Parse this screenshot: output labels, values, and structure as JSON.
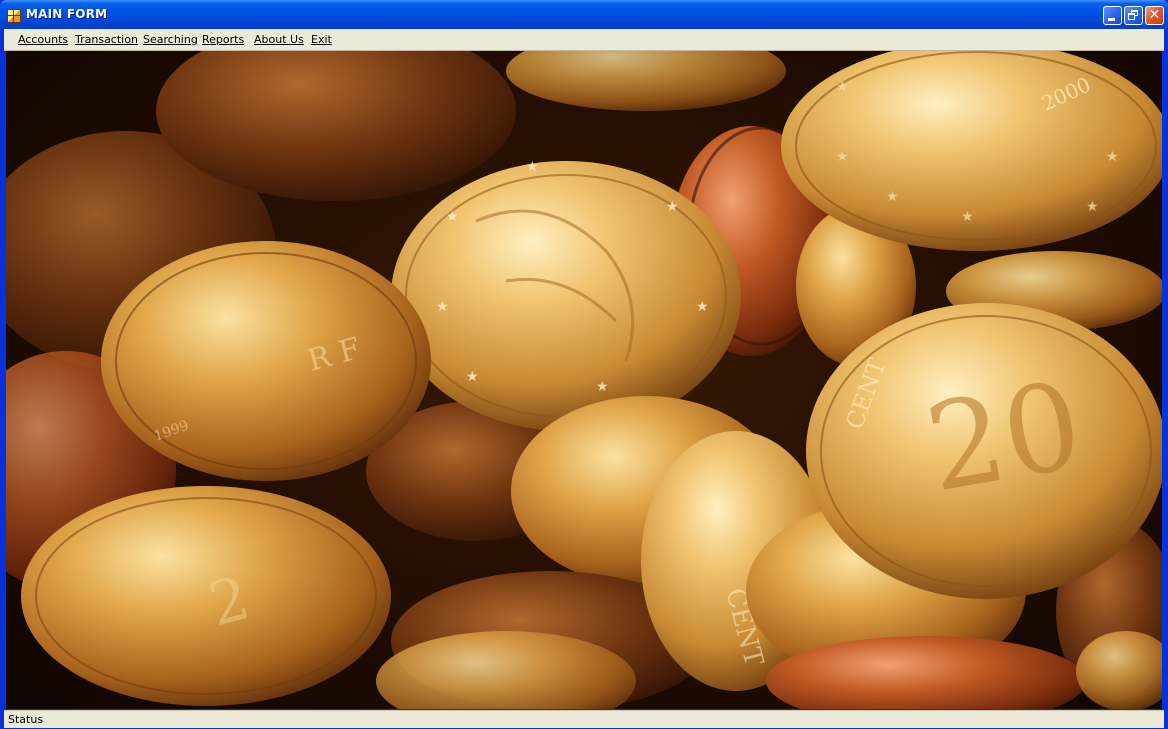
{
  "window": {
    "title": "MAIN FORM",
    "title_bar_color": "#0054e3"
  },
  "title_buttons": {
    "minimize_icon": "minimize-icon",
    "restore_icon": "restore-icon",
    "close_icon": "close-icon"
  },
  "menu": {
    "items": [
      {
        "label": "Accounts"
      },
      {
        "label": "Transaction"
      },
      {
        "label": "Searching"
      },
      {
        "label": "Reports"
      },
      {
        "label": "About Us"
      },
      {
        "label": "Exit"
      }
    ]
  },
  "background_image": {
    "subject": "pile of euro cent coins",
    "dominant_colors": [
      "#c8892e",
      "#e8b860",
      "#7a3610",
      "#2a1005"
    ]
  },
  "status": {
    "text": "Status"
  }
}
